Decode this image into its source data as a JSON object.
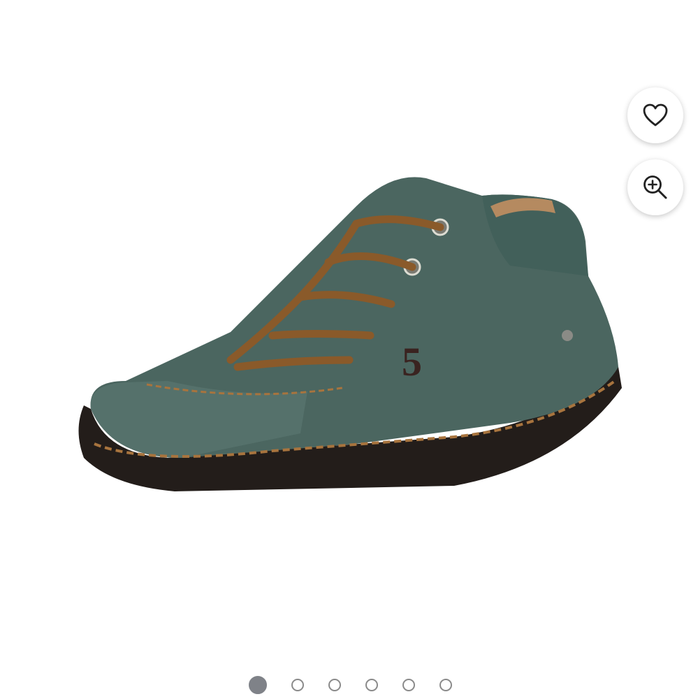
{
  "header": {
    "cut_text": ""
  },
  "gallery": {
    "image_label": "",
    "actions": [
      {
        "icon": "heart-icon",
        "label": ""
      },
      {
        "icon": "zoom-in-icon",
        "label": ""
      }
    ],
    "pagination": {
      "count": 6,
      "active_index": 0
    }
  },
  "colors": {
    "shoe_upper": "#4b6660",
    "laces": "#8a5a2a",
    "sole": "#231d1a",
    "active_dot": "#7f8288",
    "inactive_dot_border": "#8a8a8a"
  }
}
